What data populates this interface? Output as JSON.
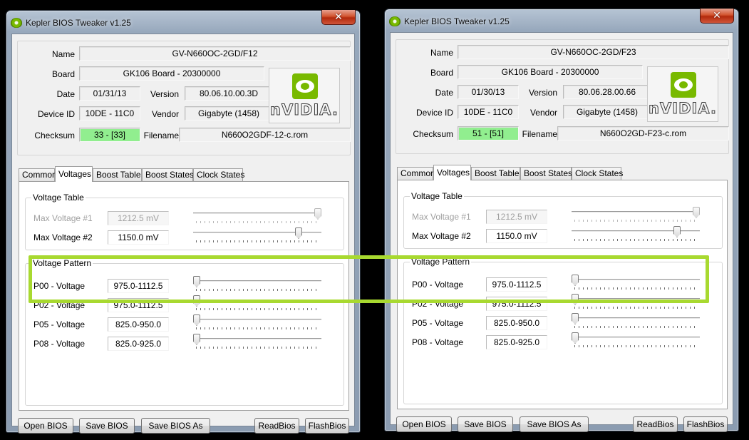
{
  "windows": [
    {
      "title": "Kepler BIOS Tweaker v1.25",
      "close_label": "✕",
      "name_label": "Name",
      "name": "GV-N660OC-2GD/F12",
      "board_label": "Board",
      "board": "GK106 Board - 20300000",
      "date_label": "Date",
      "date": "01/31/13",
      "version_label": "Version",
      "version": "80.06.10.00.3D",
      "device_id_label": "Device ID",
      "device_id": "10DE - 11C0",
      "vendor_label": "Vendor",
      "vendor": "Gigabyte (1458)",
      "checksum_label": "Checksum",
      "checksum": "33 - [33]",
      "filename_label": "Filename",
      "filename": "N660O2GDF-12-c.rom",
      "logo_text": "nVIDIA.",
      "tabs": [
        "Common",
        "Voltages",
        "Boost Table",
        "Boost States",
        "Clock States"
      ],
      "active_tab": "Voltages",
      "voltage_table_title": "Voltage Table",
      "voltage_table": [
        {
          "label": "Max Voltage #1",
          "value": "1212.5 mV",
          "enabled": false,
          "slider": 1.0
        },
        {
          "label": "Max Voltage #2",
          "value": "1150.0 mV",
          "enabled": true,
          "slider": 0.84
        }
      ],
      "voltage_pattern_title": "Voltage Pattern",
      "voltage_pattern": [
        {
          "label": "P00 - Voltage",
          "value": "975.0-1112.5",
          "slider": 0.0
        },
        {
          "label": "P02 - Voltage",
          "value": "975.0-1112.5",
          "slider": 0.0
        },
        {
          "label": "P05 - Voltage",
          "value": "825.0-950.0",
          "slider": 0.0
        },
        {
          "label": "P08 - Voltage",
          "value": "825.0-925.0",
          "slider": 0.0
        }
      ],
      "buttons": {
        "open": "Open BIOS",
        "save": "Save BIOS",
        "save_as": "Save BIOS As",
        "read": "ReadBios",
        "flash": "FlashBios"
      }
    },
    {
      "title": "Kepler BIOS Tweaker v1.25",
      "close_label": "✕",
      "name_label": "Name",
      "name": "GV-N660OC-2GD/F23",
      "board_label": "Board",
      "board": "GK106 Board - 20300000",
      "date_label": "Date",
      "date": "01/30/13",
      "version_label": "Version",
      "version": "80.06.28.00.66",
      "device_id_label": "Device ID",
      "device_id": "10DE - 11C0",
      "vendor_label": "Vendor",
      "vendor": "Gigabyte (1458)",
      "checksum_label": "Checksum",
      "checksum": "51 - [51]",
      "filename_label": "Filename",
      "filename": "N660O2GD-F23-c.rom",
      "logo_text": "nVIDIA.",
      "tabs": [
        "Common",
        "Voltages",
        "Boost Table",
        "Boost States",
        "Clock States"
      ],
      "active_tab": "Voltages",
      "voltage_table_title": "Voltage Table",
      "voltage_table": [
        {
          "label": "Max Voltage #1",
          "value": "1212.5 mV",
          "enabled": false,
          "slider": 1.0
        },
        {
          "label": "Max Voltage #2",
          "value": "1150.0 mV",
          "enabled": true,
          "slider": 0.84
        }
      ],
      "voltage_pattern_title": "Voltage Pattern",
      "voltage_pattern": [
        {
          "label": "P00 - Voltage",
          "value": "975.0-1112.5",
          "slider": 0.0
        },
        {
          "label": "P02 - Voltage",
          "value": "975.0-1112.5",
          "slider": 0.0
        },
        {
          "label": "P05 - Voltage",
          "value": "825.0-950.0",
          "slider": 0.0
        },
        {
          "label": "P08 - Voltage",
          "value": "825.0-925.0",
          "slider": 0.0
        }
      ],
      "buttons": {
        "open": "Open BIOS",
        "save": "Save BIOS",
        "save_as": "Save BIOS As",
        "read": "ReadBios",
        "flash": "FlashBios"
      }
    }
  ],
  "colors": {
    "checksum_ok": "#91ee8f",
    "highlight": "#a8d930",
    "nvidia_green": "#78b900"
  },
  "icons": {
    "app": "nvidia-eye-icon",
    "close": "close-icon"
  }
}
